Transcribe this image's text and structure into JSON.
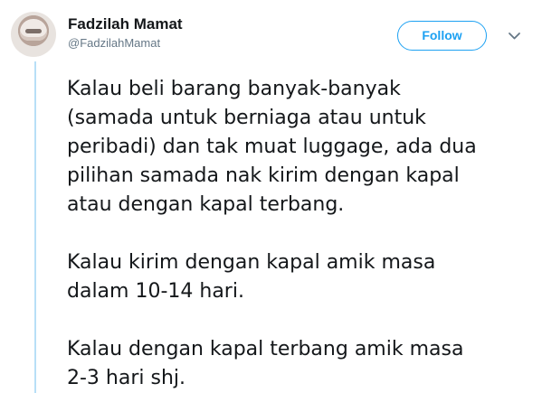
{
  "tweet": {
    "author": {
      "display_name": "Fadzilah Mamat",
      "handle": "@FadzilahMamat",
      "avatar_icon": "profile-photo-avatar"
    },
    "actions": {
      "follow_label": "Follow",
      "menu_icon": "chevron-down-icon"
    },
    "paragraphs": [
      "Kalau beli barang banyak-banyak\n(samada untuk berniaga atau untuk\nperibadi) dan tak muat luggage, ada dua\npilihan samada nak kirim dengan kapal\natau dengan kapal terbang.",
      "Kalau kirim dengan kapal amik masa\ndalam 10-14 hari.",
      "Kalau dengan kapal terbang amik masa\n2-3 hari shj."
    ],
    "colors": {
      "accent": "#1da1f2",
      "text": "#14171a",
      "secondary_text": "#657786",
      "thread_line": "#b8dff7"
    }
  }
}
